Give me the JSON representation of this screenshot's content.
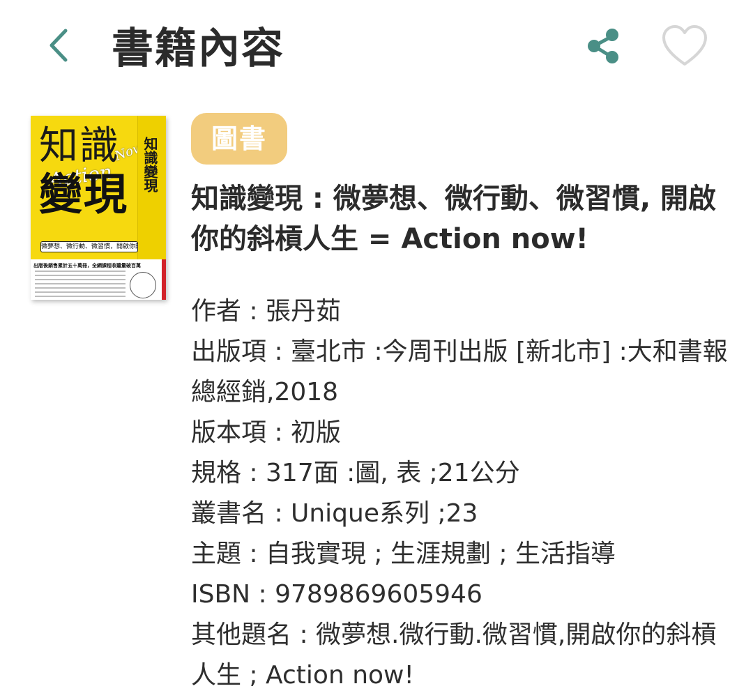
{
  "header": {
    "title": "書籍內容",
    "back_icon": "chevron-left-icon",
    "share_icon": "share-icon",
    "favorite_icon": "heart-outline-icon",
    "icon_color": "#4a8f86",
    "favorite_color": "#d6d6d6"
  },
  "cover": {
    "title_top": "知識",
    "title_bottom": "變現",
    "action_text": "Action",
    "now_text": "Now!",
    "spine_text": "知識變現",
    "subtitle": "微夢想、微行動、微習慣，開啟你的斜槓人生",
    "tagline": "出版後銷售累計五十萬冊，全網課程收聽量破百萬",
    "background_color": "#f6d90f"
  },
  "book": {
    "category_tag": "圖書",
    "category_color": "#f2cc7e",
    "title": "知識變現 : 微夢想、微行動、微習慣, 開啟你的斜槓人生 = Action now!"
  },
  "details": [
    "作者 : 張丹茹",
    "出版項 : 臺北市 :今周刊出版  [新北市] :大和書報總經銷,2018",
    "版本項 : 初版",
    "規格 : 317面 :圖, 表 ;21公分",
    "叢書名 : Unique系列 ;23",
    "主題 : 自我實現 ; 生涯規劃 ; 生活指導",
    "ISBN : 9789869605946",
    "其他題名 : 微夢想.微行動.微習慣,開啟你的斜槓人生 ; Action now!"
  ]
}
